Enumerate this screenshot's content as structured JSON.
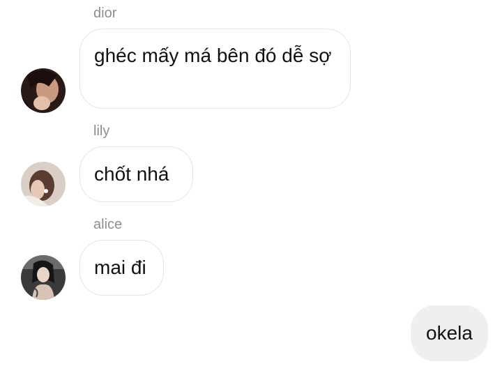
{
  "messages": [
    {
      "sender": "dior",
      "text": "ghéc mấy má bên đó dễ sợ",
      "avatar_icon": "profile-photo-icon"
    },
    {
      "sender": "lily",
      "text": "chốt nhá",
      "avatar_icon": "profile-photo-icon"
    },
    {
      "sender": "alice",
      "text": "mai đi",
      "avatar_icon": "profile-photo-icon"
    }
  ],
  "my_message": {
    "text": "okela"
  },
  "colors": {
    "background": "#ffffff",
    "sender_name": "#8e8e8e",
    "bubble_border": "#e3e3e3",
    "my_bubble": "#efefef",
    "text": "#111111"
  }
}
